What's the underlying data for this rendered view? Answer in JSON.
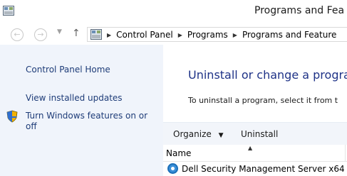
{
  "window": {
    "title": "Programs and Fea"
  },
  "navigation": {
    "back_icon": "back-arrow-icon",
    "forward_icon": "forward-arrow-icon",
    "up_icon": "up-arrow-icon",
    "breadcrumbs": [
      "Control Panel",
      "Programs",
      "Programs and Feature"
    ]
  },
  "sidebar": {
    "items": [
      {
        "label": "Control Panel Home"
      },
      {
        "label": "View installed updates"
      },
      {
        "label": "Turn Windows features on or",
        "label2": "off",
        "icon": "shield-icon"
      }
    ]
  },
  "main": {
    "heading": "Uninstall or change a prograr",
    "instruction": "To uninstall a program, select it from t"
  },
  "toolbar": {
    "organize": "Organize",
    "uninstall": "Uninstall"
  },
  "list": {
    "columns": [
      "Name"
    ],
    "rows": [
      {
        "name": "Dell Security Management Server x64",
        "icon": "dell-app-icon"
      }
    ]
  },
  "colors": {
    "sidebar_bg": "#f0f4fb",
    "link": "#1e3c78",
    "heading": "#1e3287",
    "toolbar_bg": "#f2f5fa"
  }
}
